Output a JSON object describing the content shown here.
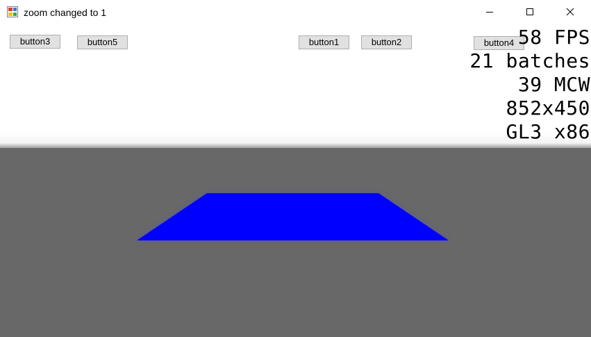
{
  "window": {
    "title": "zoom changed to 1",
    "icon": "app-icon",
    "controls": {
      "minimize_icon": "minimize-icon",
      "maximize_icon": "maximize-icon",
      "close_icon": "close-icon"
    }
  },
  "buttons": {
    "button3": "button3",
    "button5": "button5",
    "button1": "button1",
    "button2": "button2",
    "button4": "button4"
  },
  "stats": {
    "fps": "58 FPS",
    "batches": "21 batches",
    "mcw": "39 MCW",
    "resolution": "852x450",
    "renderer": "GL3 x86"
  },
  "scene": {
    "plane_color": "#0000ff",
    "floor_color": "#686868",
    "sky_color": "#ffffff"
  }
}
